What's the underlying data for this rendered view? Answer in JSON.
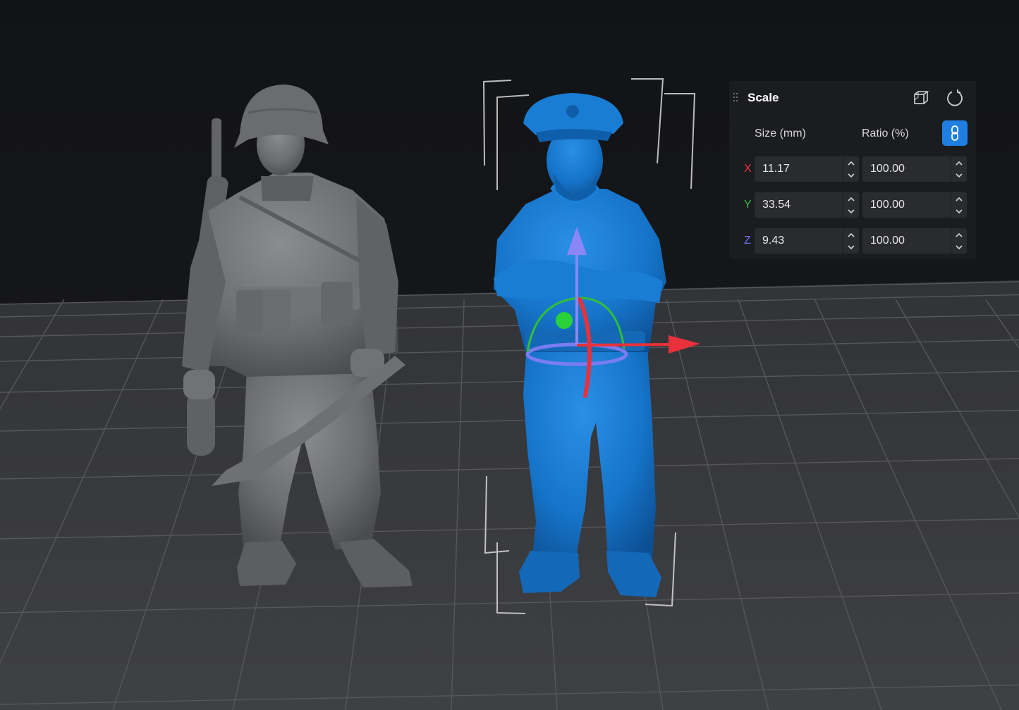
{
  "scene": {
    "background": "#141517",
    "floor_color": "#3a3b3e",
    "grid_line_color": "#55575b",
    "unselected_model_color": "#6c6e71",
    "selected_model_color": "#1674c9",
    "gizmo_colors": {
      "x_arrow": "#e8313a",
      "y_arrow": "#8a86f5",
      "rotate_ring_green": "#2fbf3a",
      "rotate_ring_blue": "#7a7cf2",
      "rotate_ring_red": "#e8313a",
      "rotate_handle": "#29d13a"
    }
  },
  "scale_panel": {
    "title": "Scale",
    "icons": {
      "drag": "drag-handle-icon",
      "box": "cube-outline-icon",
      "reset": "reset-rotate-icon",
      "link": "chain-link-icon"
    },
    "size_label": "Size (mm)",
    "ratio_label": "Ratio (%)",
    "link_active_color": "#1f7fe0",
    "rows": [
      {
        "axis": "X",
        "axis_color": "#e8313a",
        "size": "11.17",
        "ratio": "100.00"
      },
      {
        "axis": "Y",
        "axis_color": "#2fbf3a",
        "size": "33.54",
        "ratio": "100.00"
      },
      {
        "axis": "Z",
        "axis_color": "#6f72f0",
        "size": "9.43",
        "ratio": "100.00"
      }
    ]
  }
}
